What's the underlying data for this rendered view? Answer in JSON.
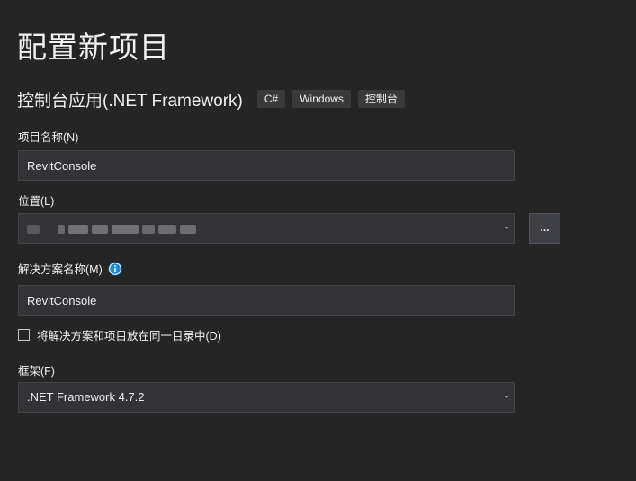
{
  "dialog": {
    "title": "配置新项目"
  },
  "template": {
    "name": "控制台应用(.NET Framework)",
    "tags": [
      "C#",
      "Windows",
      "控制台"
    ]
  },
  "project_name": {
    "label": "项目名称(N)",
    "value": "RevitConsole"
  },
  "location": {
    "label": "位置(L)",
    "value_obscured": true,
    "browse_label": "..."
  },
  "solution_name": {
    "label": "解决方案名称(M)",
    "value": "RevitConsole",
    "info_icon": "info-icon"
  },
  "same_directory": {
    "label": "将解决方案和项目放在同一目录中(D)",
    "checked": false
  },
  "framework": {
    "label": "框架(F)",
    "selected": ".NET Framework 4.7.2"
  },
  "colors": {
    "background": "#252526",
    "input_background": "#333337",
    "info_accent": "#1e8ad6"
  }
}
